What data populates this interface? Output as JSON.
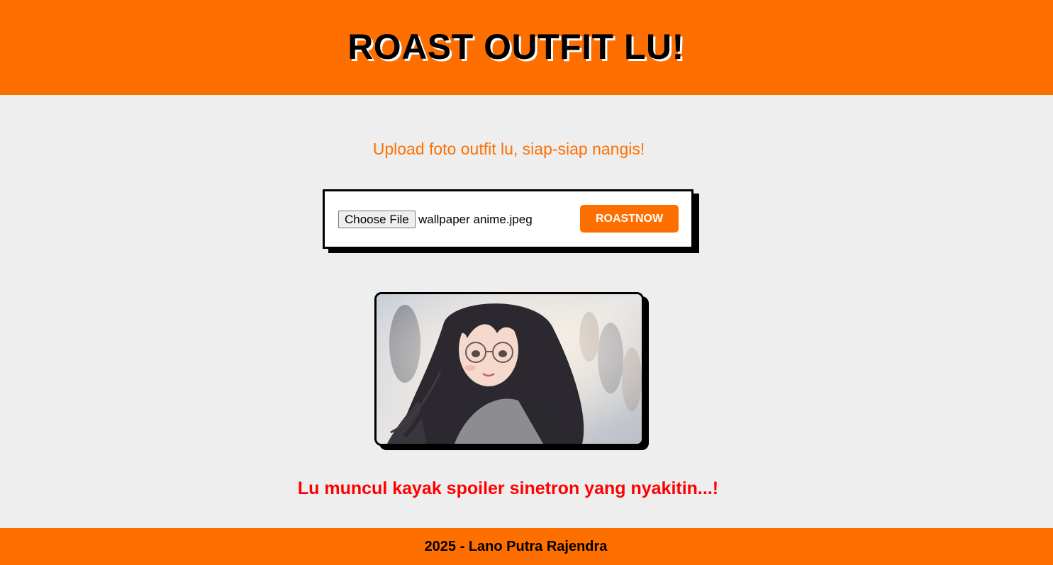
{
  "header": {
    "title": "ROAST OUTFIT LU!"
  },
  "main": {
    "subtitle": "Upload foto outfit lu, siap-siap nangis!",
    "upload": {
      "choose_file_label": "Choose File",
      "file_name": "wallpaper anime.jpeg",
      "roast_button_label": "ROASTNOW"
    },
    "preview": {
      "icon": "uploaded-outfit-image"
    },
    "result_text": "Lu muncul kayak spoiler sinetron yang nyakitin...!"
  },
  "footer": {
    "text": "2025 - Lano Putra Rajendra"
  },
  "colors": {
    "accent": "#ff6f00",
    "background": "#eeeeee",
    "result": "#ff0000"
  }
}
